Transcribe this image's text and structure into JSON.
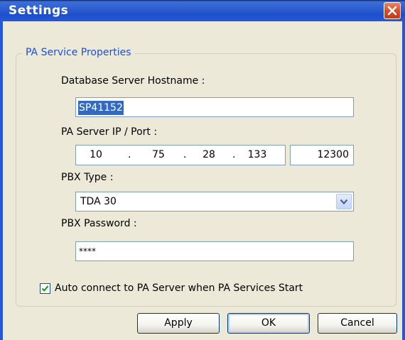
{
  "window": {
    "title": "Settings",
    "close_icon": "close-icon"
  },
  "group": {
    "legend": "PA Service Properties"
  },
  "fields": {
    "hostname": {
      "label": "Database Server Hostname :",
      "value": "SP41152"
    },
    "ip_port": {
      "label": "PA Server IP / Port :",
      "ip": [
        "10",
        "75",
        "28",
        "133"
      ],
      "dot": ".",
      "port": "12300"
    },
    "pbx_type": {
      "label": "PBX Type :",
      "selected": "TDA 30",
      "dropdown_icon": "chevron-down-icon"
    },
    "pbx_password": {
      "label": "PBX Password :",
      "masked_value": "****"
    },
    "auto_connect": {
      "label": "Auto connect to PA Server when PA Services Start",
      "checked": true
    }
  },
  "buttons": {
    "apply": "Apply",
    "ok": "OK",
    "cancel": "Cancel"
  },
  "colors": {
    "title_bar": "#2757d6",
    "legend_text": "#1f4fcf",
    "selection": "#316ac5",
    "close_button": "#d94f2a",
    "dialog_bg": "#ece9d8"
  }
}
